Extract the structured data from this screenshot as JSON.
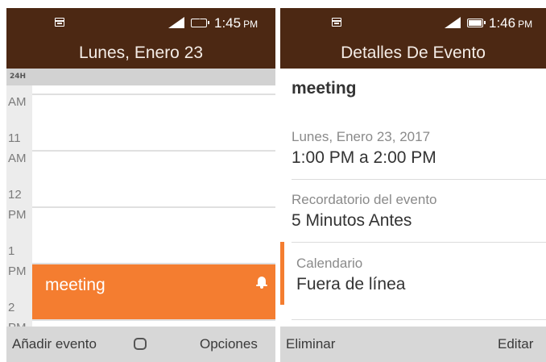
{
  "left_screen": {
    "status": {
      "time": "1:45",
      "ampm": "PM"
    },
    "title": "Lunes, Enero 23",
    "view_mode": "24H",
    "hour_labels": [
      "AM",
      "11",
      "AM",
      "12",
      "PM",
      "1",
      "PM",
      "2",
      "PM"
    ],
    "event": {
      "title": "meeting",
      "icon": "bell-icon",
      "color": "#f47d30"
    },
    "softkeys": {
      "left": "Añadir evento",
      "center_icon": "rounded-square-icon",
      "right": "Opciones"
    }
  },
  "right_screen": {
    "status": {
      "time": "1:46",
      "ampm": "PM"
    },
    "title": "Detalles De Evento",
    "event_name": "meeting",
    "date": "Lunes, Enero 23, 2017",
    "time_range": "1:00 PM a 2:00 PM",
    "reminder_label": "Recordatorio del evento",
    "reminder_value": "5 Minutos Antes",
    "calendar_label": "Calendario",
    "calendar_value": "Fuera de línea",
    "softkeys": {
      "left": "Eliminar",
      "right": "Editar"
    }
  },
  "colors": {
    "header": "#4c2813",
    "accent": "#f47d30",
    "softkey_bar": "#d7d7d7"
  }
}
